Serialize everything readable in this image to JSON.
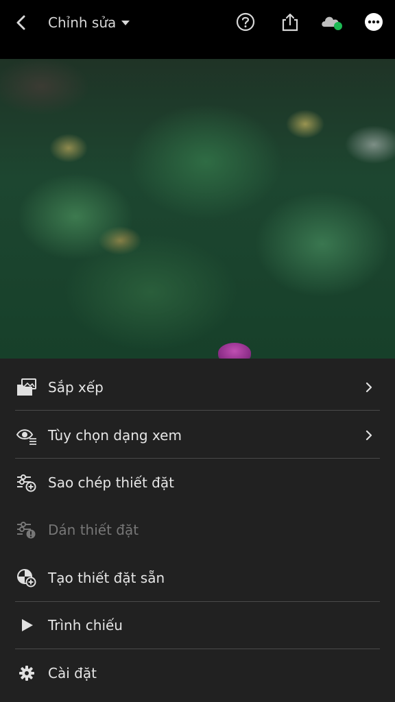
{
  "header": {
    "title": "Chỉnh sửa",
    "icons": [
      "back-icon",
      "help-icon",
      "share-icon",
      "cloud-sync-icon",
      "more-icon"
    ],
    "sync_status_color": "#1db954"
  },
  "menu": {
    "items": [
      {
        "label": "Sắp xếp",
        "icon": "organize-icon",
        "has_submenu": true,
        "enabled": true
      },
      {
        "label": "Tùy chọn dạng xem",
        "icon": "view-options-icon",
        "has_submenu": true,
        "enabled": true
      },
      {
        "label": "Sao chép thiết đặt",
        "icon": "copy-settings-icon",
        "has_submenu": false,
        "enabled": true
      },
      {
        "label": "Dán thiết đặt",
        "icon": "paste-settings-icon",
        "has_submenu": false,
        "enabled": false
      },
      {
        "label": "Tạo thiết đặt sẵn",
        "icon": "create-preset-icon",
        "has_submenu": false,
        "enabled": true
      },
      {
        "label": "Trình chiếu",
        "icon": "play-icon",
        "has_submenu": false,
        "enabled": true
      },
      {
        "label": "Cài đặt",
        "icon": "gear-icon",
        "has_submenu": false,
        "enabled": true
      }
    ]
  }
}
